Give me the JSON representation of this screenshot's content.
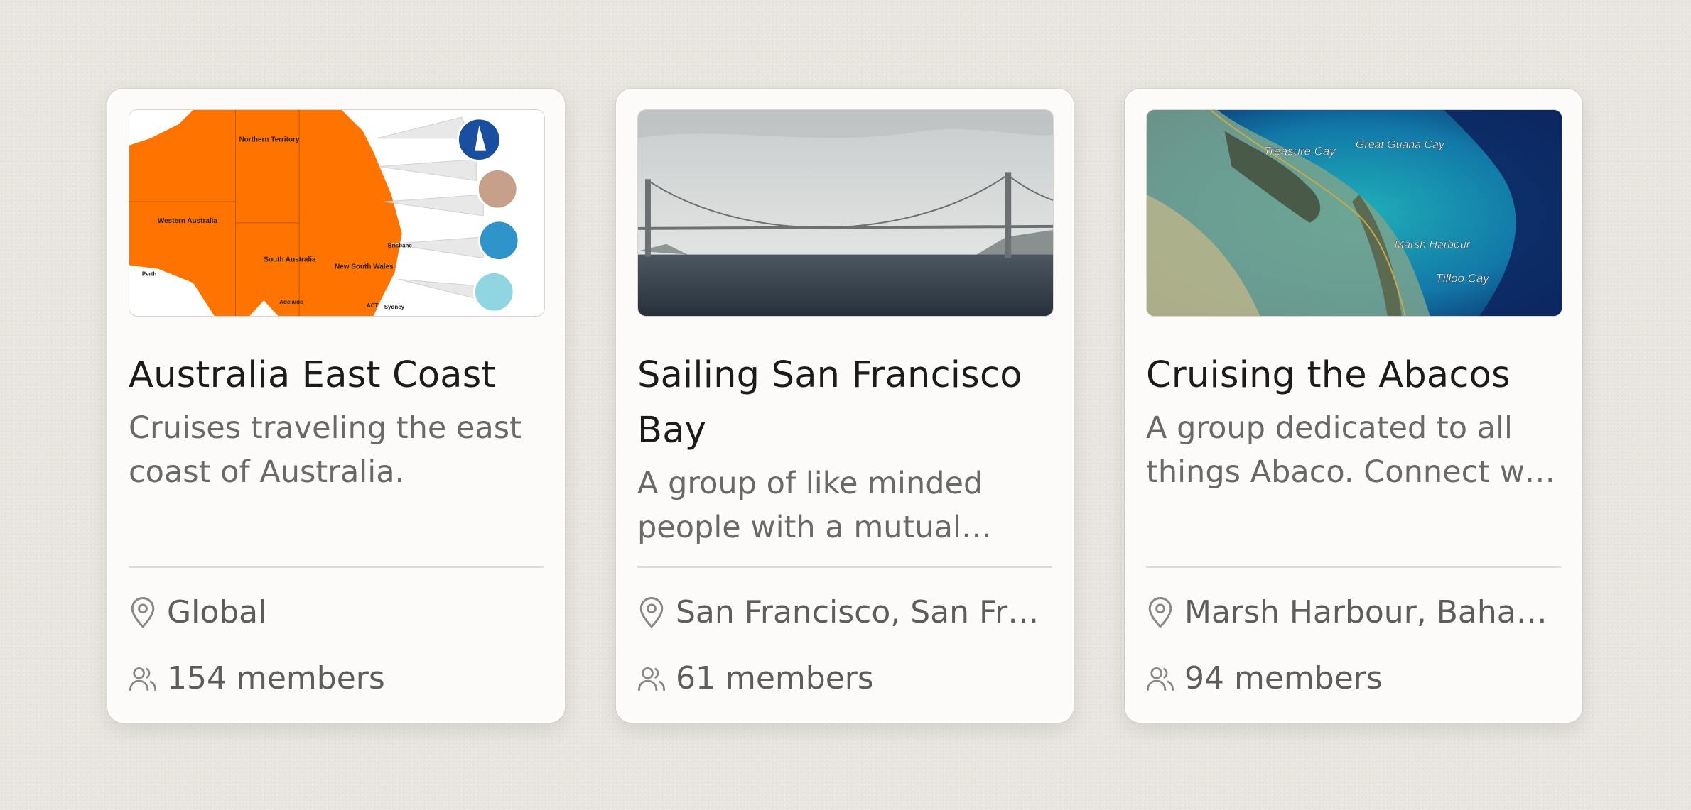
{
  "cards": [
    {
      "title": "Australia East Coast",
      "description": "Cruises traveling the east coast of Australia.",
      "location": "Global",
      "members": "154 members",
      "image_labels": [
        "Northern Territory",
        "Western Australia",
        "South Australia",
        "New South Wales",
        "Perth",
        "Adelaide",
        "Brisbane",
        "Sydney",
        "ACT"
      ]
    },
    {
      "title": "Sailing San Francisco Bay",
      "description": "A group of like minded people with a mutual des…",
      "location": "San Francisco, San Fr…",
      "members": "61 members"
    },
    {
      "title": "Cruising the Abacos",
      "description": "A group dedicated to all things Abaco. Connect w…",
      "location": "Marsh Harbour, Baha…",
      "members": "94 members",
      "image_labels": [
        "Treasure Cay",
        "Great Guana Cay",
        "Marsh Harbour",
        "Tilloo Cay"
      ]
    }
  ],
  "icons": {
    "location": "map-pin-icon",
    "members": "users-icon"
  },
  "colors": {
    "background": "#e9e6e0",
    "card": "#fcfbf9",
    "title": "#1b1b1b",
    "muted": "#6b6966",
    "map_orange": "#ff7300"
  }
}
